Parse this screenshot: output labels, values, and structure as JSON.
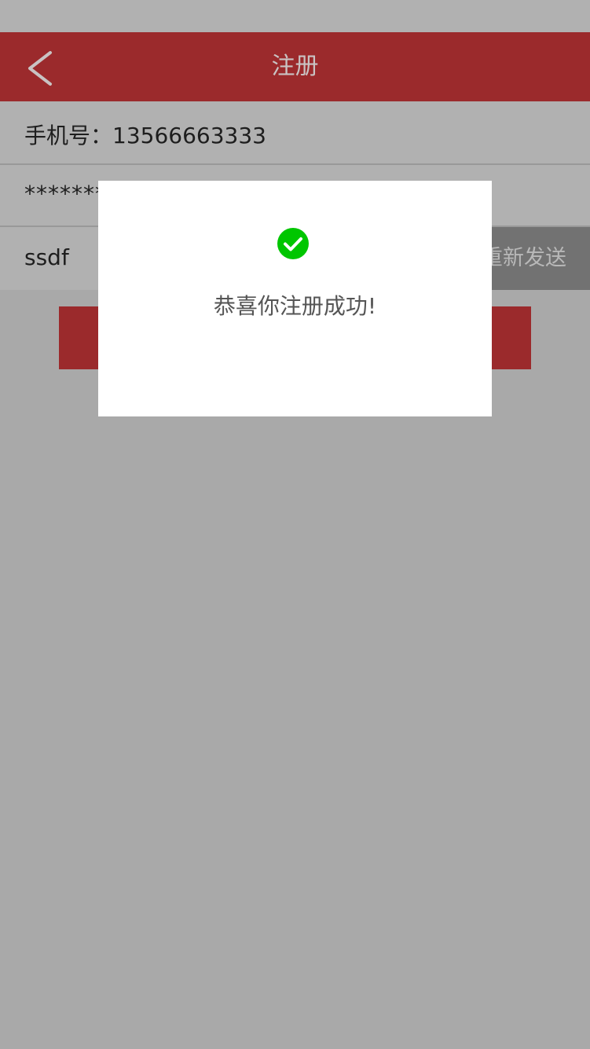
{
  "header": {
    "title": "注册",
    "back_icon": "chevron-left-icon"
  },
  "form": {
    "phone_text": "手机号：13566663333",
    "password_masked": "*******",
    "code_value": "ssdf",
    "resend_label": "重新发送",
    "submit_label": ""
  },
  "dialog": {
    "icon": "check-circle-icon",
    "message": "恭喜你注册成功!"
  },
  "colors": {
    "header_bg": "#9b2a2c",
    "overlay_bg": "#a9a9a9",
    "success_green": "#00c600"
  }
}
